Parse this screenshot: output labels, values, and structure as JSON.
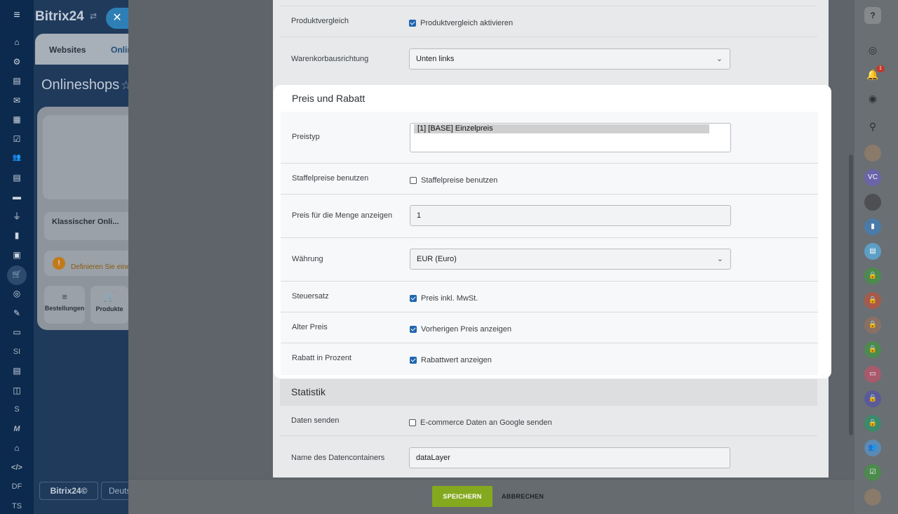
{
  "left_bar": {
    "items": [
      "≡",
      "⌂",
      "⚙",
      "▤",
      "✉",
      "▦",
      "☑",
      "👥",
      "▤",
      "▬",
      "⏚",
      "▮",
      "▣",
      "🛒",
      "◎",
      "✎",
      "▭",
      "SI",
      "▤",
      "◫",
      "S",
      "M",
      "⌂",
      "</>",
      "DF",
      "TS"
    ]
  },
  "background_app": {
    "logo": "Bitrix24",
    "logo_sub": "⇄",
    "close_label": "✕",
    "tabs": [
      "Websites",
      "Onlin"
    ],
    "page_title": "Onlineshops",
    "star": "☆",
    "shop_name": "Klassischer Onli...",
    "warning_text": "Definieren Sie eine",
    "buttons": [
      "Bestellungen",
      "Produkte"
    ],
    "bottom_logo": "Bitrix24©",
    "bottom_lang": "Deuts"
  },
  "form": {
    "top_rows": [
      {
        "label": "Produktvergleich",
        "checkbox_label": "Produktvergleich aktivieren",
        "checked": true
      },
      {
        "label": "Warenkorbausrichtung",
        "select_value": "Unten links"
      }
    ],
    "card": {
      "title": "Preis und Rabatt",
      "price_type_label": "Preistyp",
      "price_type_option": "[1] [BASE] Einzelpreis",
      "tiered_label": "Staffelpreise benutzen",
      "tiered_checkbox_label": "Staffelpreise benutzen",
      "tiered_checked": false,
      "qty_label": "Preis für die Menge anzeigen",
      "qty_value": "1",
      "currency_label": "Währung",
      "currency_value": "EUR (Euro)",
      "tax_label": "Steuersatz",
      "tax_checkbox_label": "Preis inkl. MwSt.",
      "tax_checked": true,
      "old_price_label": "Alter Preis",
      "old_price_checkbox_label": "Vorherigen Preis anzeigen",
      "old_price_checked": true,
      "discount_label": "Rabatt in Prozent",
      "discount_checkbox_label": "Rabattwert anzeigen",
      "discount_checked": true
    },
    "statistics": {
      "title": "Statistik",
      "send_label": "Daten senden",
      "send_checkbox_label": "E-commerce Daten an Google senden",
      "send_checked": false,
      "container_label": "Name des Datencontainers",
      "container_value": "dataLayer"
    }
  },
  "bottom_bar": {
    "save_label": "SPEICHERN",
    "cancel_label": "ABBRECHEN"
  },
  "right_rail": {
    "help": "?",
    "bell_badge": "1",
    "avatar_vc": "VC"
  },
  "colors": {
    "save_green": "#84a91f",
    "checkbox_blue": "#2066b0",
    "sidebar_dark": "#0c2a4d"
  }
}
